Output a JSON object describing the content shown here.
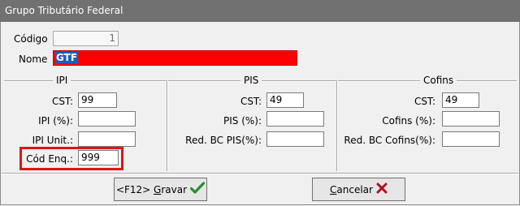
{
  "window": {
    "title": "Grupo Tributário Federal"
  },
  "form": {
    "codigo_label": "Código",
    "codigo_value": "1",
    "nome_label": "Nome",
    "nome_value": "GTF"
  },
  "ipi": {
    "title": "IPI",
    "cst_label": "CST:",
    "cst_value": "99",
    "pct_label": "IPI (%):",
    "pct_value": "",
    "unit_label": "IPI Unit.:",
    "unit_value": "",
    "enq_label": "Cód Enq.:",
    "enq_value": "999"
  },
  "pis": {
    "title": "PIS",
    "cst_label": "CST:",
    "cst_value": "49",
    "pct_label": "PIS (%):",
    "pct_value": "",
    "redbc_label": "Red. BC PIS(%):",
    "redbc_value": ""
  },
  "cofins": {
    "title": "Cofins",
    "cst_label": "CST:",
    "cst_value": "49",
    "pct_label": "Cofins (%):",
    "pct_value": "",
    "redbc_label": "Red. BC Cofins(%):",
    "redbc_value": ""
  },
  "buttons": {
    "gravar_prefix": "<F12> ",
    "gravar_hotkey": "G",
    "gravar_rest": "ravar",
    "cancelar_hotkey": "C",
    "cancelar_rest": "ancelar"
  },
  "colors": {
    "title_bar": "#717171",
    "name_field": "#ff0000",
    "highlight_box": "#e0141a",
    "check_icon": "#2e8b2e",
    "cancel_icon": "#b01020"
  }
}
